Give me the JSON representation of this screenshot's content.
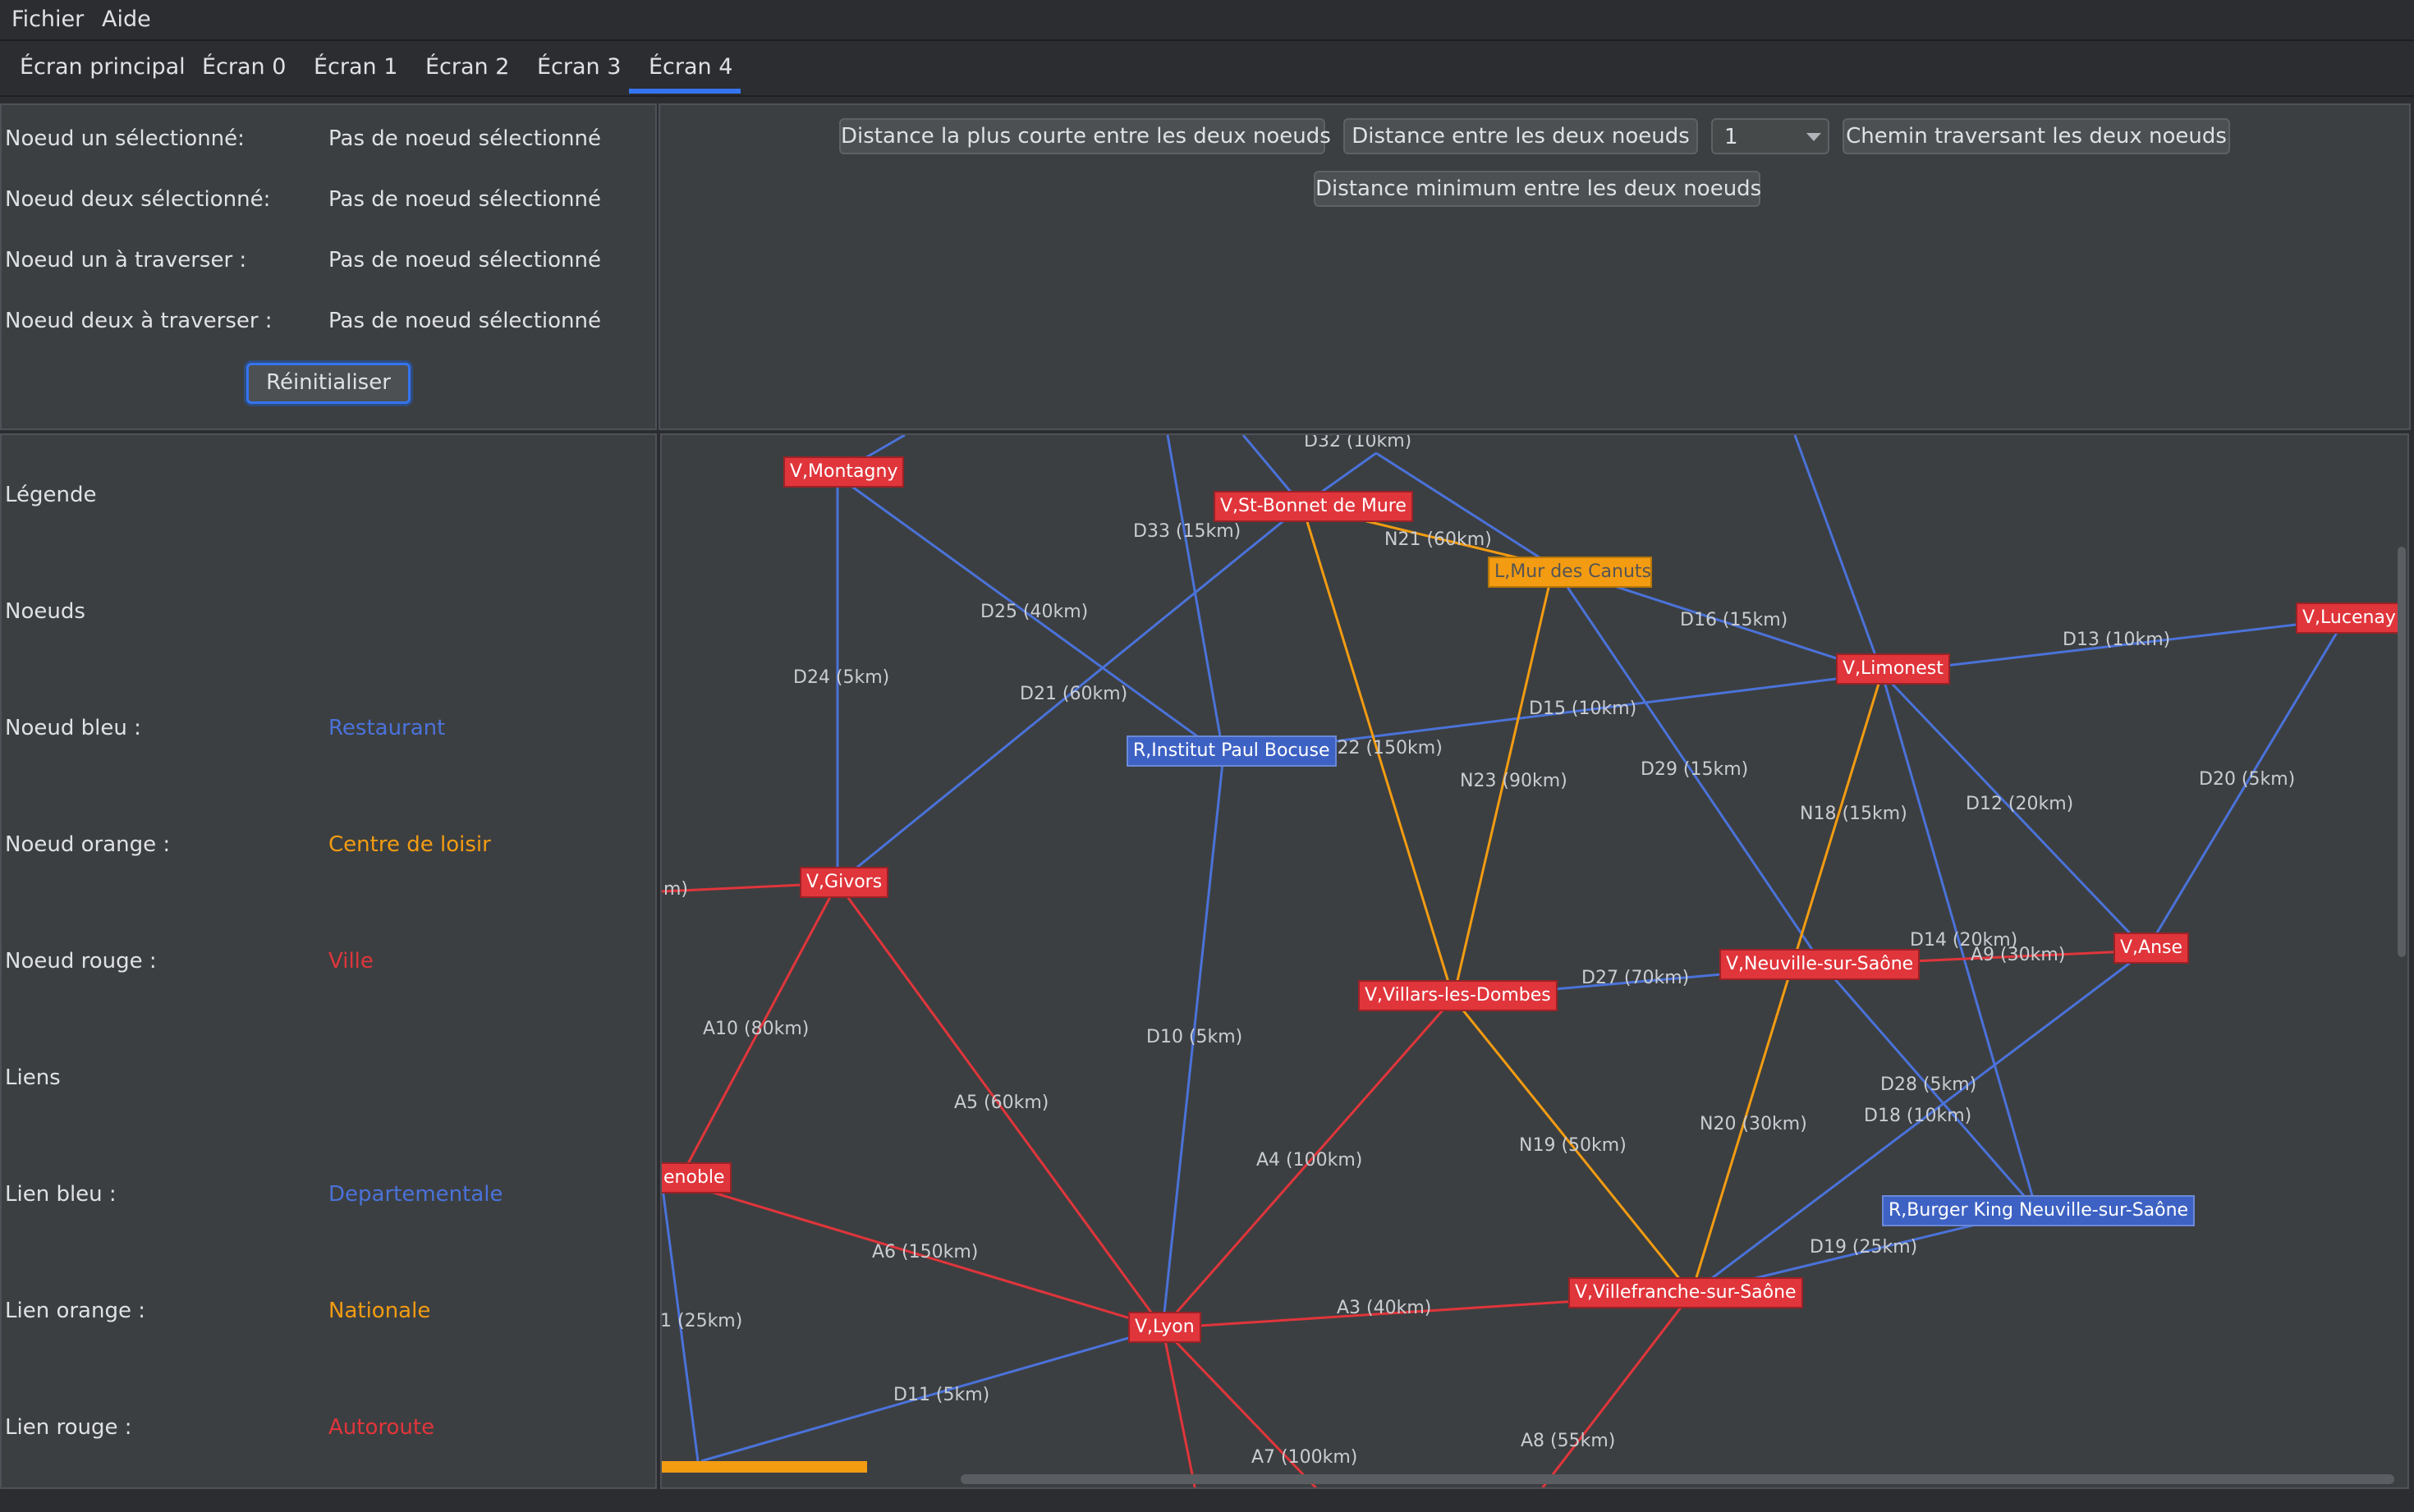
{
  "menu": {
    "items": [
      "Fichier",
      "Aide"
    ]
  },
  "tabs": [
    "Écran principal",
    "Écran 0",
    "Écran 1",
    "Écran 2",
    "Écran 3",
    "Écran 4"
  ],
  "active_tab": "Écran 4",
  "selection": {
    "rows": [
      {
        "label": "Noeud un sélectionné:",
        "value": "Pas de noeud sélectionné"
      },
      {
        "label": "Noeud deux sélectionné:",
        "value": "Pas de noeud sélectionné"
      },
      {
        "label": "Noeud un à traverser :",
        "value": "Pas de noeud sélectionné"
      },
      {
        "label": "Noeud deux à traverser :",
        "value": "Pas de noeud sélectionné"
      }
    ],
    "reset_label": "Réinitialiser"
  },
  "actions": {
    "shortest_label": "Distance la plus courte entre les deux noeuds",
    "distance_label": "Distance entre les deux noeuds",
    "combo_value": "1",
    "path_label": "Chemin traversant les deux noeuds",
    "min_label": "Distance minimum entre les deux noeuds"
  },
  "legend": {
    "title": "Légende",
    "nodes_title": "Noeuds",
    "links_title": "Liens",
    "items": [
      {
        "label": "Noeud bleu :",
        "value": "Restaurant",
        "color": "#4a72d9"
      },
      {
        "label": "Noeud orange :",
        "value": "Centre de loisir",
        "color": "#f39c12"
      },
      {
        "label": "Noeud rouge :",
        "value": "Ville",
        "color": "#e0353b"
      },
      {
        "label": "Lien bleu :",
        "value": "Departementale",
        "color": "#4a72d9"
      },
      {
        "label": "Lien orange :",
        "value": "Nationale",
        "color": "#f39c12"
      },
      {
        "label": "Lien rouge :",
        "value": "Autoroute",
        "color": "#e0353b"
      }
    ]
  },
  "graph": {
    "nodes": [
      {
        "id": "montagny",
        "text": "V,Montagny",
        "kind": "ville"
      },
      {
        "id": "stbonnet",
        "text": "V,St-Bonnet de Mure",
        "kind": "ville"
      },
      {
        "id": "mur",
        "text": "L,Mur des Canuts",
        "kind": "loisir"
      },
      {
        "id": "lucenay",
        "text": "V,Lucenay",
        "kind": "ville"
      },
      {
        "id": "limonest",
        "text": "V,Limonest",
        "kind": "ville"
      },
      {
        "id": "bocuse",
        "text": "R,Institut Paul Bocuse",
        "kind": "resto"
      },
      {
        "id": "givors",
        "text": "V,Givors",
        "kind": "ville"
      },
      {
        "id": "villars",
        "text": "V,Villars-les-Dombes",
        "kind": "ville"
      },
      {
        "id": "neuville",
        "text": "V,Neuville-sur-Saône",
        "kind": "ville"
      },
      {
        "id": "anse",
        "text": "V,Anse",
        "kind": "ville"
      },
      {
        "id": "grenoble",
        "text": "enoble",
        "kind": "ville"
      },
      {
        "id": "burger",
        "text": "R,Burger King Neuville-sur-Saône",
        "kind": "resto"
      },
      {
        "id": "villefranche",
        "text": "V,Villefranche-sur-Saône",
        "kind": "ville"
      },
      {
        "id": "lyon",
        "text": "V,Lyon",
        "kind": "ville"
      }
    ],
    "edge_labels": [
      "D32 (10km)",
      "D33 (15km)",
      "N21 (60km)",
      "D25 (40km)",
      "D16 (15km)",
      "D13 (10km)",
      "D24 (5km)",
      "D21 (60km)",
      "D15 (10km)",
      "N22 (150km)",
      "D29 (15km)",
      "N23 (90km)",
      "N18 (15km)",
      "D12 (20km)",
      "D20 (5km)",
      "m)",
      "D14 (20km)",
      "A9 (30km)",
      "D27 (70km)",
      "A10 (80km)",
      "D10 (5km)",
      "A5 (60km)",
      "D28 (5km)",
      "N20 (30km)",
      "D18 (10km)",
      "A4 (100km)",
      "N19 (50km)",
      "D19 (25km)",
      "A6 (150km)",
      "A3 (40km)",
      "1 (25km)",
      "D11 (5km)",
      "A7 (100km)",
      "A8 (55km)"
    ]
  }
}
